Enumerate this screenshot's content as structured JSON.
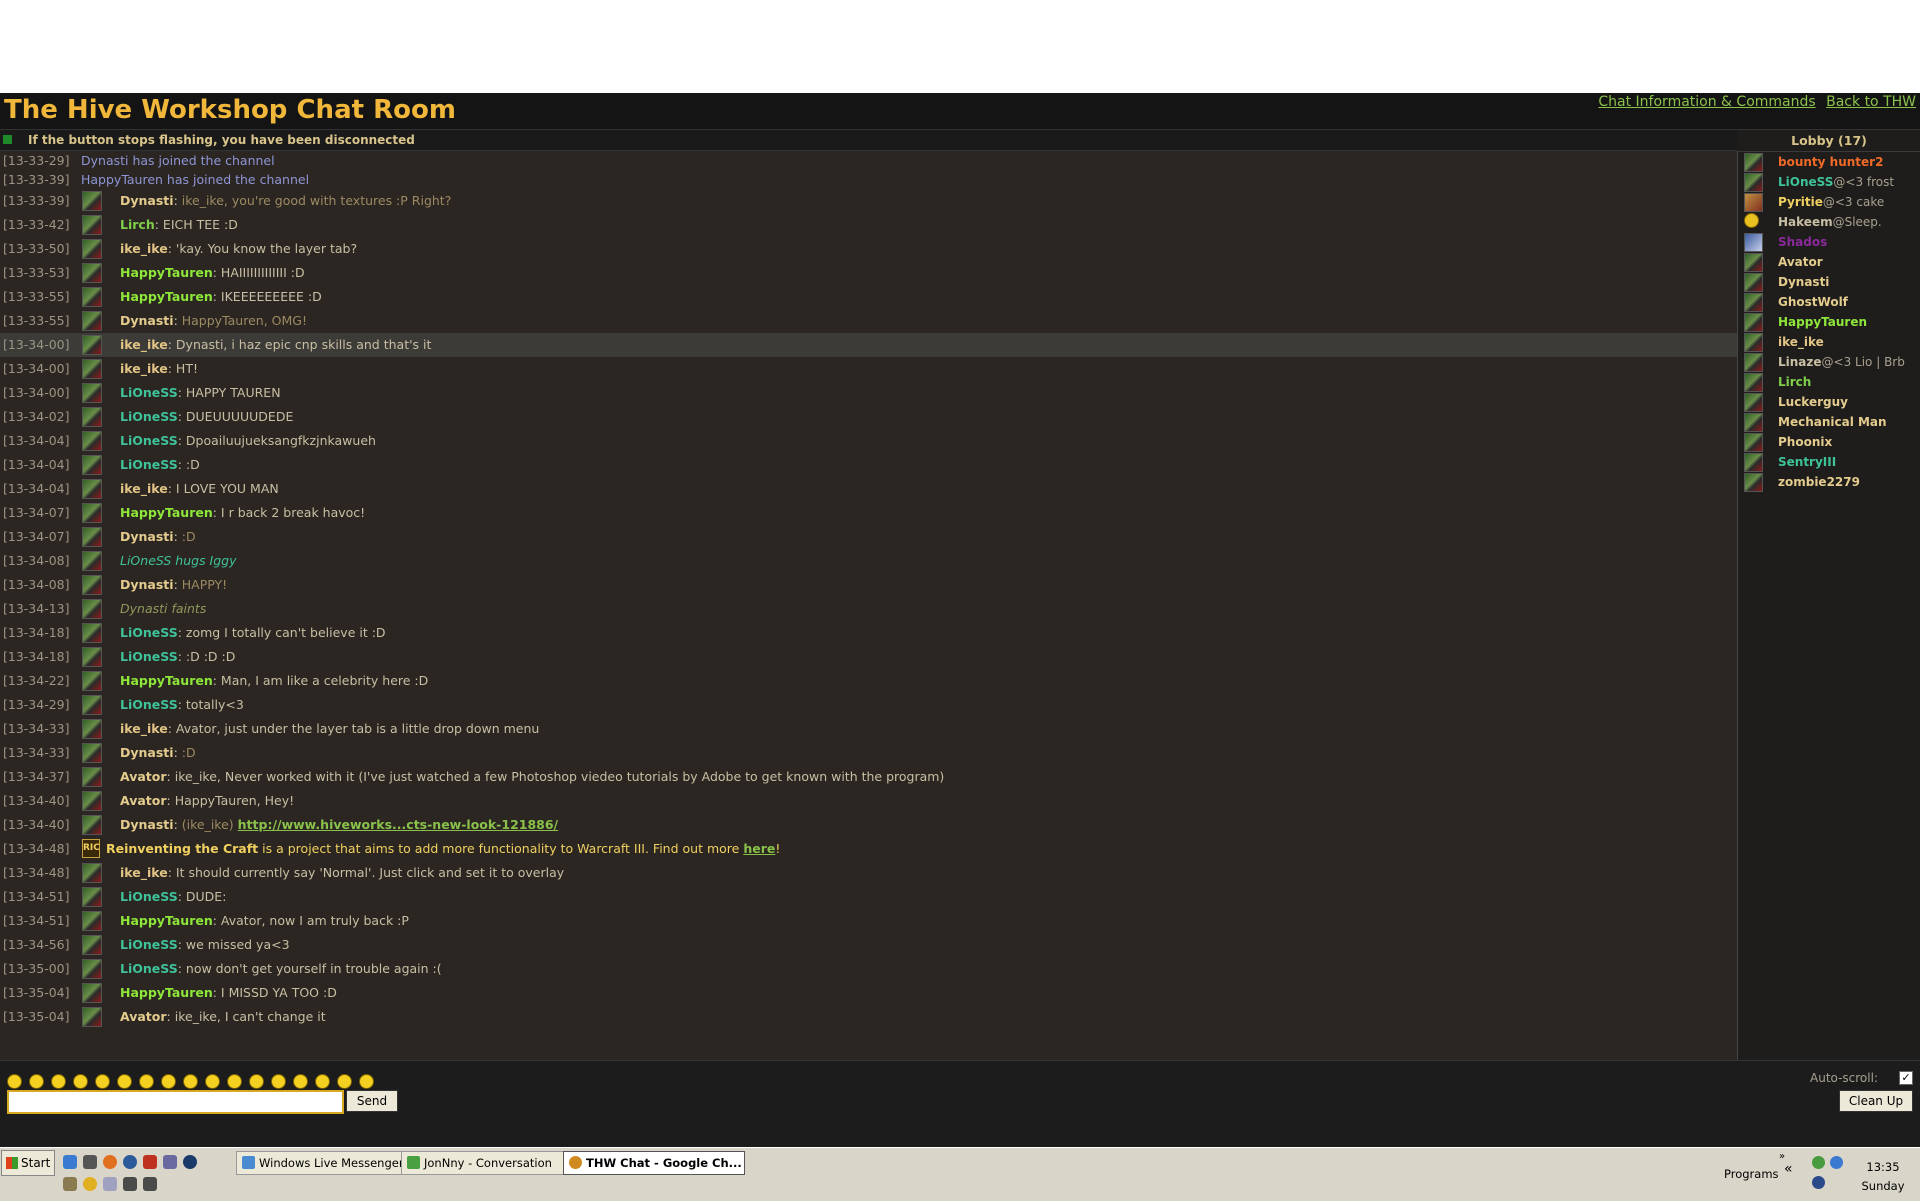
{
  "app": {
    "title": "The Hive Workshop Chat Room",
    "links": [
      "Chat Information & Commands",
      "Back to THW"
    ],
    "status_notice": "If the button stops flashing, you have been disconnected"
  },
  "chat": {
    "messages": [
      {
        "time": "[13-33-29]",
        "type": "join",
        "text": "Dynasti has joined the channel"
      },
      {
        "time": "[13-33-39]",
        "type": "join",
        "text": "HappyTauren has joined the channel"
      },
      {
        "time": "[13-33-39]",
        "type": "msg",
        "user": "Dynasti",
        "ucls": "c-dyn",
        "tcls": "t-dyn",
        "text": "ike_ike, you're good with textures :P Right?"
      },
      {
        "time": "[13-33-42]",
        "type": "msg",
        "user": "Lirch",
        "ucls": "c-lirch",
        "tcls": "t-def",
        "text": "EICH TEE :D"
      },
      {
        "time": "[13-33-50]",
        "type": "msg",
        "user": "ike_ike",
        "ucls": "c-ike",
        "tcls": "t-def",
        "text": "'kay. You know the layer tab?"
      },
      {
        "time": "[13-33-53]",
        "type": "msg",
        "user": "HappyTauren",
        "ucls": "c-happy",
        "tcls": "t-def",
        "text": "HAIIIIIIIIIIIII :D"
      },
      {
        "time": "[13-33-55]",
        "type": "msg",
        "user": "HappyTauren",
        "ucls": "c-happy",
        "tcls": "t-def",
        "text": "IKEEEEEEEEE :D"
      },
      {
        "time": "[13-33-55]",
        "type": "msg",
        "user": "Dynasti",
        "ucls": "c-dyn",
        "tcls": "t-dyn",
        "text": "HappyTauren, OMG!"
      },
      {
        "time": "[13-34-00]",
        "type": "msg",
        "user": "ike_ike",
        "ucls": "c-ike",
        "tcls": "t-def",
        "text": "Dynasti, i haz epic cnp skills and that's it",
        "highlight": true
      },
      {
        "time": "[13-34-00]",
        "type": "msg",
        "user": "ike_ike",
        "ucls": "c-ike",
        "tcls": "t-def",
        "text": "HT!"
      },
      {
        "time": "[13-34-00]",
        "type": "msg",
        "user": "LiOneSS",
        "ucls": "c-lion",
        "tcls": "t-def",
        "text": "HAPPY TAUREN"
      },
      {
        "time": "[13-34-02]",
        "type": "msg",
        "user": "LiOneSS",
        "ucls": "c-lion",
        "tcls": "t-def",
        "text": "DUEUUUUUDEDE"
      },
      {
        "time": "[13-34-04]",
        "type": "msg",
        "user": "LiOneSS",
        "ucls": "c-lion",
        "tcls": "t-def",
        "text": "Dpoailuujueksangfkzjnkawueh"
      },
      {
        "time": "[13-34-04]",
        "type": "msg",
        "user": "LiOneSS",
        "ucls": "c-lion",
        "tcls": "t-def",
        "text": ":D"
      },
      {
        "time": "[13-34-04]",
        "type": "msg",
        "user": "ike_ike",
        "ucls": "c-ike",
        "tcls": "t-def",
        "text": "I LOVE YOU MAN"
      },
      {
        "time": "[13-34-07]",
        "type": "msg",
        "user": "HappyTauren",
        "ucls": "c-happy",
        "tcls": "t-def",
        "text": "I r back 2 break havoc!"
      },
      {
        "time": "[13-34-07]",
        "type": "msg",
        "user": "Dynasti",
        "ucls": "c-dyn",
        "tcls": "t-dyn",
        "text": ":D"
      },
      {
        "time": "[13-34-08]",
        "type": "emote",
        "ecls": "t-emote-lion",
        "text": "LiOneSS hugs Iggy"
      },
      {
        "time": "[13-34-08]",
        "type": "msg",
        "user": "Dynasti",
        "ucls": "c-dyn",
        "tcls": "t-dyn",
        "text": "HAPPY!"
      },
      {
        "time": "[13-34-13]",
        "type": "emote",
        "ecls": "t-emote-dyn",
        "text": "Dynasti faints"
      },
      {
        "time": "[13-34-18]",
        "type": "msg",
        "user": "LiOneSS",
        "ucls": "c-lion",
        "tcls": "t-def",
        "text": "zomg I totally can't believe it :D"
      },
      {
        "time": "[13-34-18]",
        "type": "msg",
        "user": "LiOneSS",
        "ucls": "c-lion",
        "tcls": "t-def",
        "text": ":D :D :D"
      },
      {
        "time": "[13-34-22]",
        "type": "msg",
        "user": "HappyTauren",
        "ucls": "c-happy",
        "tcls": "t-def",
        "text": "Man, I am like a celebrity here :D"
      },
      {
        "time": "[13-34-29]",
        "type": "msg",
        "user": "LiOneSS",
        "ucls": "c-lion",
        "tcls": "t-def",
        "text": "totally<3"
      },
      {
        "time": "[13-34-33]",
        "type": "msg",
        "user": "ike_ike",
        "ucls": "c-ike",
        "tcls": "t-def",
        "text": "Avator, just under the layer tab is a little drop down menu"
      },
      {
        "time": "[13-34-33]",
        "type": "msg",
        "user": "Dynasti",
        "ucls": "c-dyn",
        "tcls": "t-dyn",
        "text": ":D"
      },
      {
        "time": "[13-34-37]",
        "type": "msg",
        "user": "Avator",
        "ucls": "c-ava",
        "tcls": "t-def",
        "text": "ike_ike, Never worked with it (I've just watched a few Photoshop viedeo tutorials by Adobe to get known with the program)"
      },
      {
        "time": "[13-34-40]",
        "type": "msg",
        "user": "Avator",
        "ucls": "c-ava",
        "tcls": "t-def",
        "text": "HappyTauren, Hey!"
      },
      {
        "time": "[13-34-40]",
        "type": "link",
        "user": "Dynasti",
        "ucls": "c-dyn",
        "prefix": "(ike_ike)",
        "link": "http://www.hiveworks...cts-new-look-121886/"
      },
      {
        "time": "[13-34-48]",
        "type": "ric",
        "bold": "Reinventing the Craft",
        "text": "is a project that aims to add more functionality to Warcraft III. Find out more",
        "link": "here",
        "suffix": "!"
      },
      {
        "time": "[13-34-48]",
        "type": "msg",
        "user": "ike_ike",
        "ucls": "c-ike",
        "tcls": "t-def",
        "text": "It should currently say 'Normal'. Just click and set it to overlay"
      },
      {
        "time": "[13-34-51]",
        "type": "msg",
        "user": "LiOneSS",
        "ucls": "c-lion",
        "tcls": "t-def",
        "text": "DUDE:"
      },
      {
        "time": "[13-34-51]",
        "type": "msg",
        "user": "HappyTauren",
        "ucls": "c-happy",
        "tcls": "t-def",
        "text": "Avator, now I am truly back :P"
      },
      {
        "time": "[13-34-56]",
        "type": "msg",
        "user": "LiOneSS",
        "ucls": "c-lion",
        "tcls": "t-def",
        "text": "we missed ya<3"
      },
      {
        "time": "[13-35-00]",
        "type": "msg",
        "user": "LiOneSS",
        "ucls": "c-lion",
        "tcls": "t-def",
        "text": "now don't get yourself in trouble again :("
      },
      {
        "time": "[13-35-04]",
        "type": "msg",
        "user": "HappyTauren",
        "ucls": "c-happy",
        "tcls": "t-def",
        "text": "I MISSD YA TOO :D"
      },
      {
        "time": "[13-35-04]",
        "type": "msg",
        "user": "Avator",
        "ucls": "c-ava",
        "tcls": "t-def",
        "text": "ike_ike, I can't change it"
      }
    ]
  },
  "lobby": {
    "title": "Lobby (17)",
    "users": [
      {
        "name": "bounty hunter2",
        "status": "",
        "color": "#f06a28",
        "avatar": "default"
      },
      {
        "name": "LiOneSS",
        "status": "@<3 frost",
        "color": "#3ec29a",
        "avatar": "default"
      },
      {
        "name": "Pyritie",
        "status": "@<3 cake",
        "color": "#f0d060",
        "avatar": "pyr"
      },
      {
        "name": "Hakeem",
        "status": "@Sleep.",
        "color": "#c8bfa4",
        "avatar": "smiley"
      },
      {
        "name": "Shados",
        "status": "",
        "color": "#8a2a9a",
        "avatar": "blue"
      },
      {
        "name": "Avator",
        "status": "",
        "color": "#e4cc8e",
        "avatar": "default"
      },
      {
        "name": "Dynasti",
        "status": "",
        "color": "#e4cc8e",
        "avatar": "default"
      },
      {
        "name": "GhostWolf",
        "status": "",
        "color": "#e4cc8e",
        "avatar": "default"
      },
      {
        "name": "HappyTauren",
        "status": "",
        "color": "#8fe63a",
        "avatar": "default"
      },
      {
        "name": "ike_ike",
        "status": "",
        "color": "#e2c486",
        "avatar": "default"
      },
      {
        "name": "Linaze",
        "status": "@<3 Lio | Brb",
        "color": "#c8bfa4",
        "avatar": "default"
      },
      {
        "name": "Lirch",
        "status": "",
        "color": "#7fcf4a",
        "avatar": "default"
      },
      {
        "name": "Luckerguy",
        "status": "",
        "color": "#e4cc8e",
        "avatar": "default"
      },
      {
        "name": "Mechanical Man",
        "status": "",
        "color": "#e4cc8e",
        "avatar": "default"
      },
      {
        "name": "Phoonix",
        "status": "",
        "color": "#e4cc8e",
        "avatar": "default"
      },
      {
        "name": "SentryIII",
        "status": "",
        "color": "#3ec29a",
        "avatar": "default"
      },
      {
        "name": "zombie2279",
        "status": "",
        "color": "#e4cc8e",
        "avatar": "default"
      }
    ]
  },
  "input": {
    "send_label": "Send",
    "value": "",
    "placeholder": ""
  },
  "controls": {
    "autoscroll_label": "Auto-scroll:",
    "autoscroll_checked": "✓",
    "cleanup_label": "Clean Up"
  },
  "smileys": [
    "smile",
    "grin",
    "cool",
    "sad",
    "tongue",
    "confused",
    "neutral",
    "wink",
    "happy",
    "frown",
    "eek",
    "alert",
    "question",
    "laugh",
    "mad",
    "love",
    "lol"
  ],
  "taskbar": {
    "start_label": "Start",
    "tasks": [
      {
        "label": "Windows Live Messenger",
        "color": "#4a8ad0",
        "active": false
      },
      {
        "label": "JonNny - Conversation",
        "color": "#4aa040",
        "active": false
      },
      {
        "label": "THW Chat - Google Ch...",
        "color": "#d08a20",
        "active": true
      }
    ],
    "programs_label": "Programs",
    "clock_time": "13:35",
    "clock_day": "Sunday"
  }
}
